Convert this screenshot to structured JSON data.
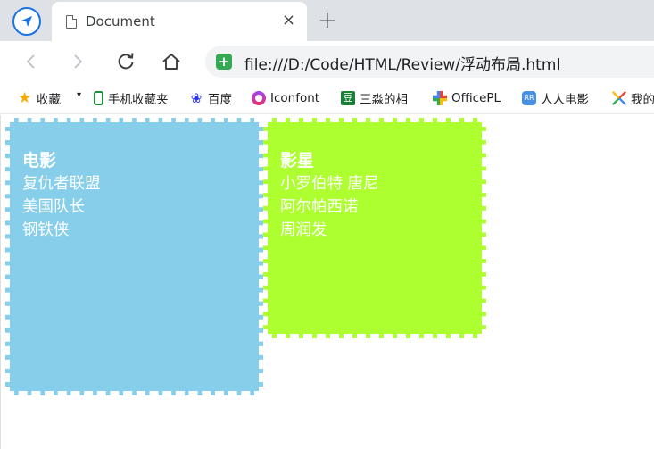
{
  "browser": {
    "tab": {
      "title": "Document",
      "close_glyph": "×"
    },
    "new_tab_glyph": "+",
    "address_bar": {
      "url": "file:///D:/Code/HTML/Review/浮动布局.html"
    },
    "colors": {
      "tab_strip": "#dee1e6",
      "accent": "#1a73e8",
      "secure": "#34a853"
    }
  },
  "bookmarks": {
    "items": [
      {
        "label": "收藏",
        "icon": "star-icon"
      },
      {
        "label": "手机收藏夹",
        "icon": "phone-icon"
      },
      {
        "label": "百度",
        "icon": "baidu-paw-icon"
      },
      {
        "label": "Iconfont",
        "icon": "iconfont-icon"
      },
      {
        "label": "三淼的相",
        "icon": "douban-icon"
      },
      {
        "label": "OfficePL",
        "icon": "office-icon"
      },
      {
        "label": "人人电影",
        "icon": "rr-icon"
      },
      {
        "label": "我的",
        "icon": "my-icon"
      }
    ]
  },
  "content": {
    "movies": {
      "title": "电影",
      "items": [
        "复仇者联盟",
        "美国队长",
        "钢铁侠"
      ],
      "color": "#87ceeb"
    },
    "stars": {
      "title": "影星",
      "items": [
        "小罗伯特 唐尼",
        "阿尔帕西诺",
        "周润发"
      ],
      "color": "#adff2f"
    }
  }
}
